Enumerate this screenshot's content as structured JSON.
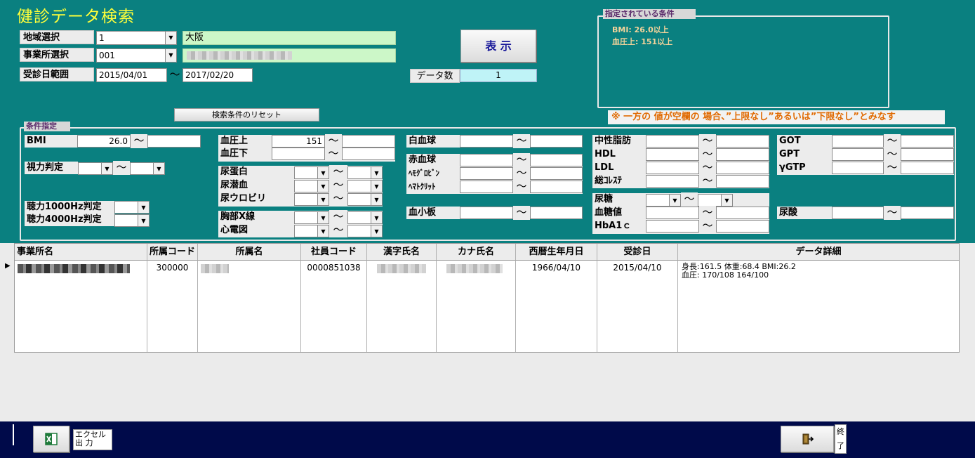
{
  "window": {
    "title": "健診データ検索"
  },
  "filters": {
    "region": {
      "label": "地域選択",
      "code": "1",
      "name": "大阪"
    },
    "office": {
      "label": "事業所選択",
      "code": "001"
    },
    "date_range": {
      "label": "受診日範囲",
      "from": "2015/04/01",
      "tilde": "〜",
      "to": "2017/02/20"
    },
    "show_button": "表 示",
    "count_label": "データ数",
    "count_value": "1",
    "reset_button": "検索条件のリセット"
  },
  "current_conditions": {
    "caption": "指定されている条件",
    "lines": [
      "BMI:  26.0以上",
      "血圧上:  151以上"
    ]
  },
  "note": "※ 一方の 値が空欄の 場合、”上限なし”あるいは”下限なし”とみなす",
  "conditions": {
    "caption": "条件指定",
    "tilde": "〜",
    "bmi": {
      "label": "BMI",
      "from": "26.0",
      "to": ""
    },
    "vision": {
      "label": "視力判定"
    },
    "hearing1000": {
      "label": "聴力1000Hz判定"
    },
    "hearing4000": {
      "label": "聴力4000Hz判定"
    },
    "bp_high": {
      "label": "血圧上",
      "from": "151",
      "to": ""
    },
    "bp_low": {
      "label": "血圧下"
    },
    "urine_protein": {
      "label": "尿蛋白"
    },
    "urine_blood": {
      "label": "尿潜血"
    },
    "urobilinogen": {
      "label": "尿ウロビリ"
    },
    "chest_xray": {
      "label": "胸部X線"
    },
    "ecg": {
      "label": "心電図"
    },
    "wbc": {
      "label": "白血球"
    },
    "rbc": {
      "label": "赤血球"
    },
    "hemoglobin": {
      "label": "ﾍﾓｸﾞﾛﾋﾞﾝ"
    },
    "hematocrit": {
      "label": "ﾍﾏﾄｸﾘｯﾄ"
    },
    "platelet": {
      "label": "血小板"
    },
    "triglyceride": {
      "label": "中性脂肪"
    },
    "hdl": {
      "label": "HDL"
    },
    "ldl": {
      "label": "LDL"
    },
    "total_chol": {
      "label": "総ｺﾚｽﾃ"
    },
    "urine_sugar": {
      "label": "尿糖"
    },
    "blood_sugar": {
      "label": "血糖値"
    },
    "hba1c": {
      "label": "HbA1ｃ"
    },
    "got": {
      "label": "GOT"
    },
    "gpt": {
      "label": "GPT"
    },
    "ggtp": {
      "label": "γGTP"
    },
    "uric_acid": {
      "label": "尿酸"
    }
  },
  "grid": {
    "columns": [
      "事業所名",
      "所属コード",
      "所属名",
      "社員コード",
      "漢字氏名",
      "カナ氏名",
      "西暦生年月日",
      "受診日",
      "データ詳細"
    ],
    "row": {
      "selector": "▶",
      "dept_code": "300000",
      "emp_code": "0000851038",
      "birth": "1966/04/10",
      "exam_date": "2015/04/10",
      "detail_line1": "身長:161.5  体重:68.4  BMI:26.2",
      "detail_line2": "血圧: 170/108   164/100"
    }
  },
  "footer": {
    "excel_label_1": "エクセル",
    "excel_label_2": "出 力",
    "exit_label_1": "終",
    "exit_label_2": "了"
  },
  "colors": {
    "background": "#0a8080",
    "title": "#ffff3a",
    "footer": "#000a4a",
    "note": "#e06a00"
  }
}
